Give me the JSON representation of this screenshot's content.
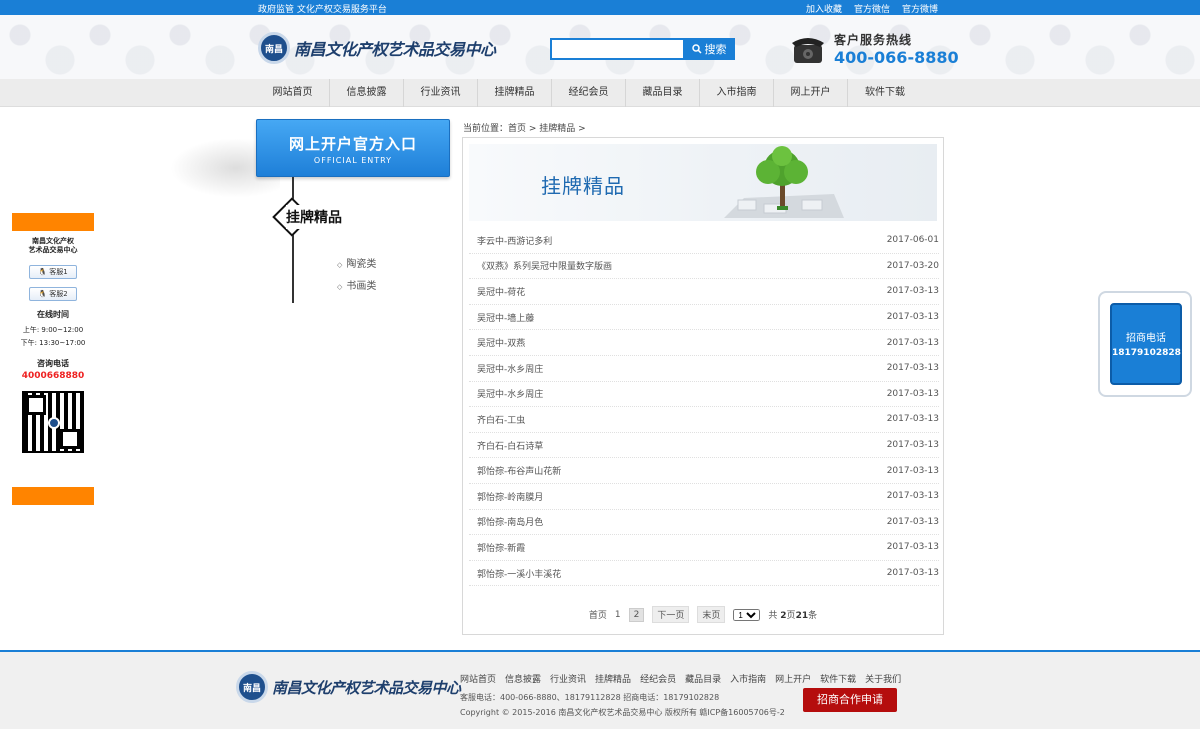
{
  "topbar": {
    "left_text": "政府监管 文化产权交易服务平台",
    "links": [
      "加入收藏",
      "官方微信",
      "官方微博"
    ]
  },
  "header": {
    "logo_text": "南昌文化产权艺术品交易中心",
    "logo_badge": "南昌",
    "search_placeholder": "",
    "search_button": "搜索",
    "hotline_label": "客户服务热线",
    "hotline_number": "400-066-8880"
  },
  "nav": [
    "网站首页",
    "信息披露",
    "行业资讯",
    "挂牌精品",
    "经纪会员",
    "藏品目录",
    "入市指南",
    "网上开户",
    "软件下载"
  ],
  "float_left": {
    "logo_text_1": "南昌文化产权",
    "logo_text_2": "艺术品交易中心",
    "qq_1": "客服1",
    "qq_2": "客服2",
    "online_title": "在线时间",
    "am": "上午:   9:00~12:00",
    "pm": "下午:  13:30~17:00",
    "consult_title": "咨询电话",
    "consult_phone": "4000668880"
  },
  "sidebar": {
    "entry_title": "网上开户官方入口",
    "entry_sub": "OFFICIAL ENTRY",
    "section_title": "挂牌精品",
    "links": [
      "陶瓷类",
      "书画类"
    ]
  },
  "breadcrumb": "当前位置：首页 > 挂牌精品 >",
  "banner_title": "挂牌精品",
  "items": [
    {
      "title": "李云中-西游记多利",
      "date": "2017-06-01"
    },
    {
      "title": "《双燕》系列吴冠中限量数字版画",
      "date": "2017-03-20"
    },
    {
      "title": "吴冠中-荷花",
      "date": "2017-03-13"
    },
    {
      "title": "吴冠中-墙上藤",
      "date": "2017-03-13"
    },
    {
      "title": "吴冠中-双燕",
      "date": "2017-03-13"
    },
    {
      "title": "吴冠中-水乡周庄",
      "date": "2017-03-13"
    },
    {
      "title": "吴冠中-水乡周庄",
      "date": "2017-03-13"
    },
    {
      "title": "齐白石-工虫",
      "date": "2017-03-13"
    },
    {
      "title": "齐白石-白石诗草",
      "date": "2017-03-13"
    },
    {
      "title": "郭怡孮-布谷声山花新",
      "date": "2017-03-13"
    },
    {
      "title": "郭怡孮-岭南膜月",
      "date": "2017-03-13"
    },
    {
      "title": "郭怡孮-南岛月色",
      "date": "2017-03-13"
    },
    {
      "title": "郭怡孮-新霞",
      "date": "2017-03-13"
    },
    {
      "title": "郭怡孮-一溪小丰溪花",
      "date": "2017-03-13"
    }
  ],
  "pager": {
    "first": "首页",
    "p1": "1",
    "p2": "2",
    "next": "下一页",
    "last": "末页",
    "select_value": "1",
    "total_prefix": "共",
    "total_pages": "2",
    "pages_unit": "页",
    "total_items": "21",
    "items_unit": "条"
  },
  "float_right": {
    "label": "招商电话",
    "phone": "18179102828"
  },
  "footer": {
    "links": [
      "网站首页",
      "信息披露",
      "行业资讯",
      "挂牌精品",
      "经纪会员",
      "藏品目录",
      "入市指南",
      "网上开户",
      "软件下载",
      "关于我们"
    ],
    "line1": "客服电话：400-066-8880、18179112828 招商电话：18179102828",
    "line2": "Copyright © 2015-2016 南昌文化产权艺术品交易中心 版权所有 赣ICP备16005706号-2",
    "apply_button": "招商合作申请"
  },
  "colors": {
    "primary": "#1a7fd6",
    "accent_orange": "#ff8400",
    "footer_button": "#b50d0d",
    "phone_red": "#e22222"
  }
}
